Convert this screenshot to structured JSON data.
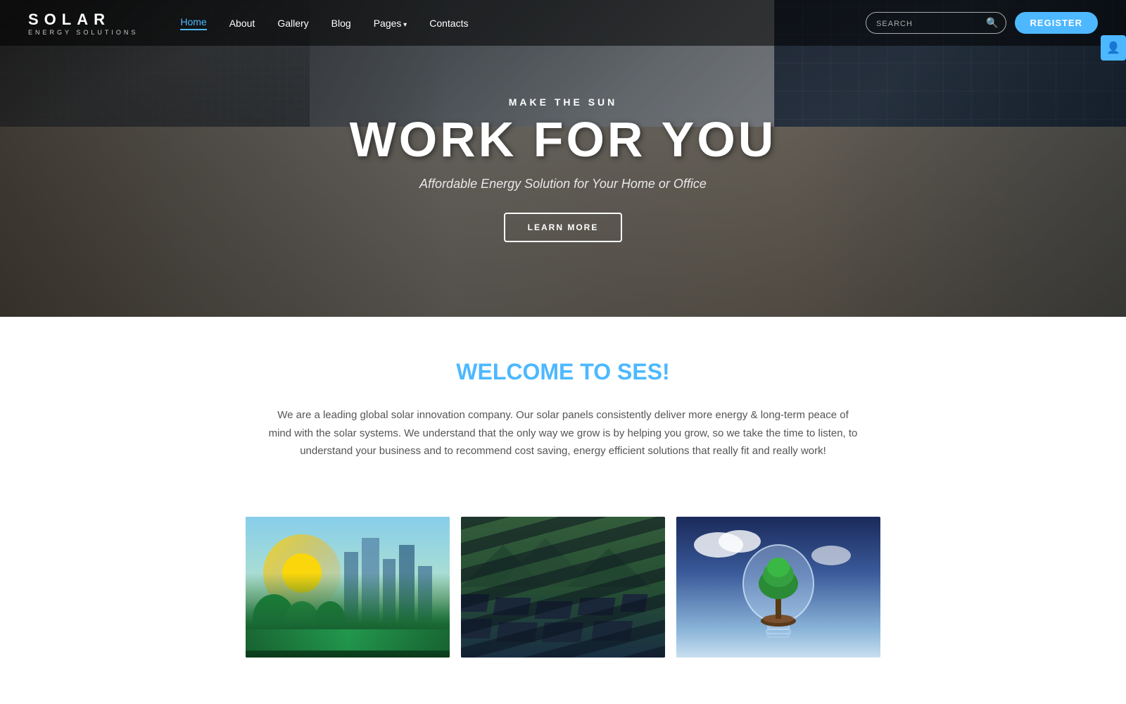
{
  "brand": {
    "name": "SOLAR",
    "subtitle": "ENERGY SOLUTIONS"
  },
  "nav": {
    "links": [
      {
        "label": "Home",
        "active": true,
        "hasArrow": false
      },
      {
        "label": "About",
        "active": false,
        "hasArrow": false
      },
      {
        "label": "Gallery",
        "active": false,
        "hasArrow": false
      },
      {
        "label": "Blog",
        "active": false,
        "hasArrow": false
      },
      {
        "label": "Pages",
        "active": false,
        "hasArrow": true
      },
      {
        "label": "Contacts",
        "active": false,
        "hasArrow": false
      }
    ],
    "search_placeholder": "SEARCH",
    "register_label": "REGISTER"
  },
  "hero": {
    "subtitle": "MAKE THE SUN",
    "title": "WORK FOR YOU",
    "tagline": "Affordable Energy Solution for Your Home or Office",
    "cta_label": "LEARN MORE"
  },
  "welcome": {
    "title_prefix": "WELCOME TO ",
    "title_brand": "SES!",
    "description": "We are a leading global solar innovation company. Our solar panels consistently deliver more energy & long-term peace of mind with the solar systems. We understand that the only way we grow is by helping you grow, so we take the time to listen, to understand your business and to recommend cost saving, energy efficient solutions that really fit and really work!"
  },
  "colors": {
    "accent": "#4db8ff",
    "dark": "#222222",
    "text": "#555555"
  }
}
